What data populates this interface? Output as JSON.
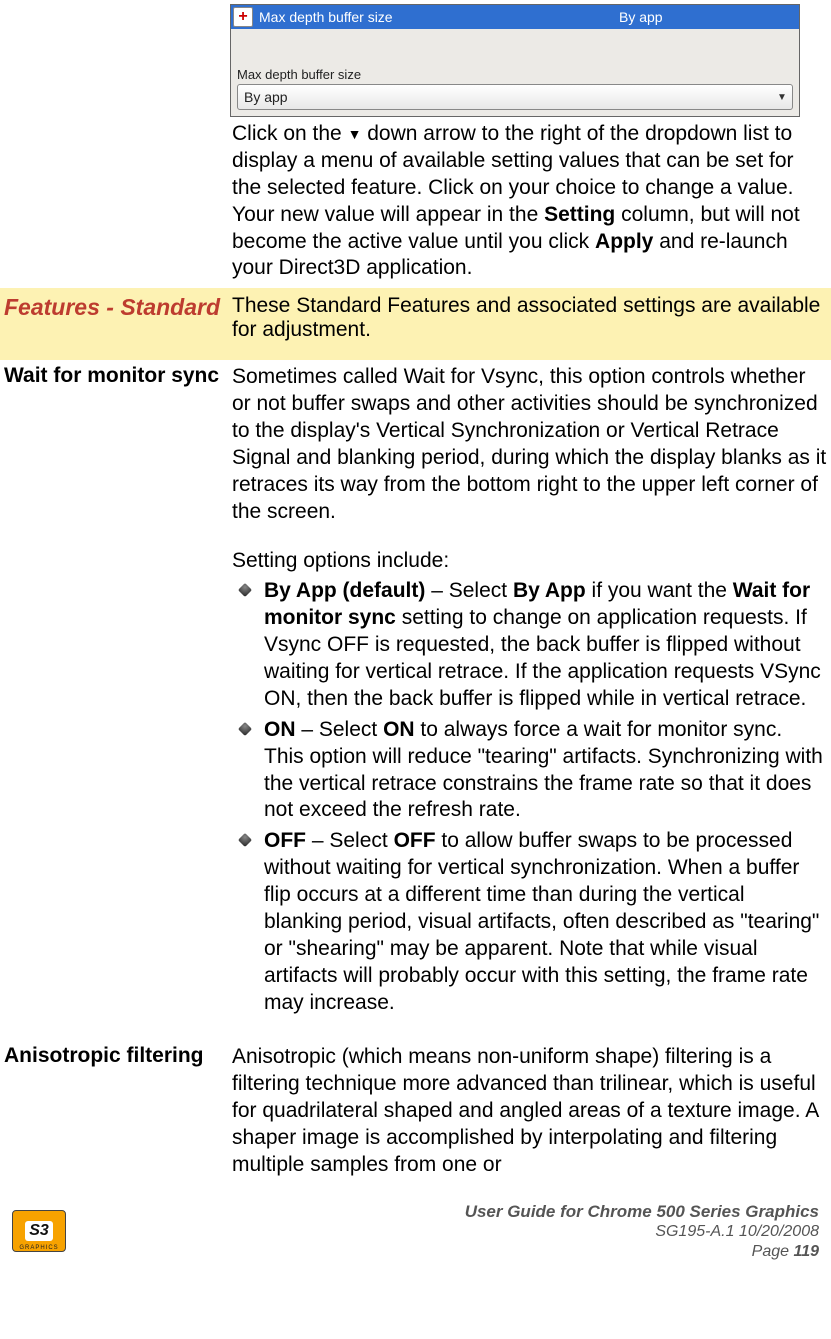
{
  "top_widget": {
    "list_item_label": "Max depth buffer size",
    "list_item_value": "By app",
    "group_label": "Max depth buffer size",
    "dropdown_value": "By app"
  },
  "intro_paragraph": {
    "pre_icon": "Click on the ",
    "post_icon": " down arrow to the right of the dropdown list to display a menu of available setting values that can be set for the selected feature. Click on your choice to change a value. Your new value will appear in the ",
    "bold1": "Setting",
    "mid1": " column, but will not become the active value until you click ",
    "bold2": "Apply",
    "tail": " and re-launch your Direct3D application."
  },
  "features_row": {
    "left": "Features - Standard",
    "right": "These Standard Features and associated settings are available for adjustment."
  },
  "wait_sync": {
    "heading": "Wait for monitor sync",
    "p1": "Sometimes called Wait for Vsync, this option controls whether or not buffer swaps and other activities should be synchronized to the display's Vertical Synchronization or Vertical Retrace Signal and blanking period, during which the display blanks as it retraces its way from the bottom right to the upper left corner of the screen.",
    "p2": "Setting options include:",
    "opts": [
      {
        "bold_lead": "By App (default)",
        "dash": " – Select ",
        "bold_inline": "By App",
        "mid": " if you want the ",
        "bold_inline2": "Wait for monitor sync",
        "rest": " setting to change on application requests. If Vsync OFF is requested, the back buffer is flipped without waiting for vertical retrace. If the application requests VSync ON, then the back buffer is flipped while in vertical retrace."
      },
      {
        "bold_lead": "ON",
        "dash": " – Select ",
        "bold_inline": "ON",
        "rest": " to always force a wait for monitor sync. This option will reduce \"tearing\" artifacts. Synchronizing with the vertical retrace constrains the frame rate so that it does not exceed the refresh rate."
      },
      {
        "bold_lead": "OFF",
        "dash": " – Select ",
        "bold_inline": "OFF",
        "rest": " to allow buffer swaps to be processed without waiting for vertical synchronization. When a buffer flip occurs at a different time than during the vertical blanking period, visual artifacts, often described as \"tearing\" or \"shearing\" may be apparent. Note that while visual artifacts will probably occur with this setting, the frame rate may increase."
      }
    ]
  },
  "aniso": {
    "heading": "Anisotropic filtering",
    "p1": "Anisotropic (which means non-uniform shape) filtering is a filtering technique more advanced than trilinear, which is useful for quadrilateral shaped and angled areas of a texture image. A shaper image is accomplished by interpolating and filtering multiple samples from one or"
  },
  "footer": {
    "logo_text": "S3",
    "logo_sub": "GRAPHICS",
    "line1": "User Guide for Chrome 500 Series Graphics",
    "line2": "SG195-A.1   10/20/2008",
    "line3_pre": "Page ",
    "page_num": "119"
  }
}
